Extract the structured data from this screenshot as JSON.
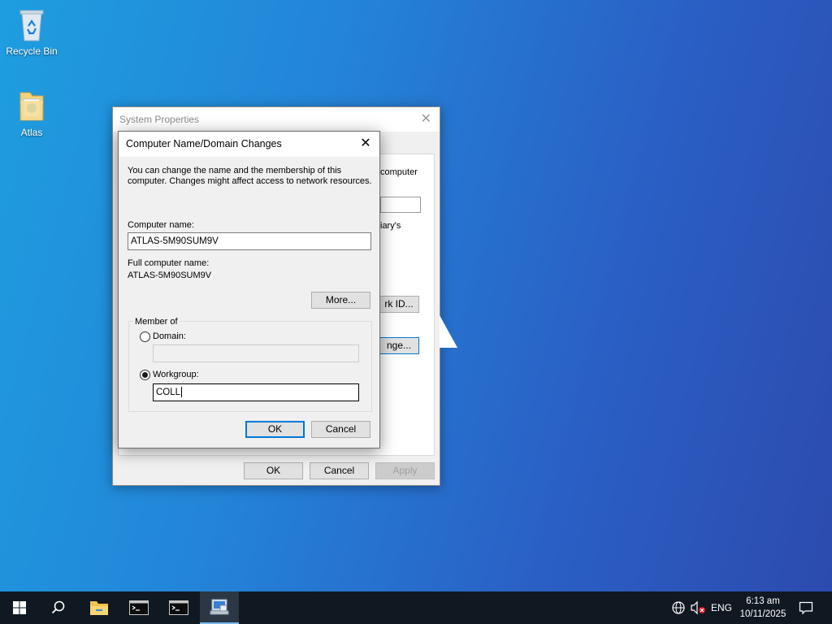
{
  "desktop": {
    "icons": [
      {
        "label": "Recycle Bin"
      },
      {
        "label": "Atlas"
      }
    ]
  },
  "system_properties": {
    "title": "System Properties",
    "partial_texts": {
      "computer": "computer",
      "arys": "iary's",
      "network_id_button": "rk ID...",
      "change_button": "nge..."
    },
    "buttons": {
      "ok": "OK",
      "cancel": "Cancel",
      "apply": "Apply"
    }
  },
  "dialog": {
    "title": "Computer Name/Domain Changes",
    "description_line1": "You can change the name and the membership of this",
    "description_line2": "computer. Changes might affect access to network resources.",
    "computer_name_label": "Computer name:",
    "computer_name_value": "ATLAS-5M90SUM9V",
    "full_name_label": "Full computer name:",
    "full_name_value": "ATLAS-5M90SUM9V",
    "more_button": "More...",
    "member_of_label": "Member of",
    "domain_label": "Domain:",
    "domain_value": "",
    "workgroup_label": "Workgroup:",
    "workgroup_value": "COLL",
    "selected_membership": "workgroup",
    "ok_button": "OK",
    "cancel_button": "Cancel"
  },
  "taskbar": {
    "items": [
      "start-icon",
      "search-icon",
      "file-explorer-icon",
      "terminal-icon",
      "terminal-icon",
      "system-properties-icon"
    ],
    "tray": {
      "language": "ENG",
      "time": "6:13 am",
      "date": "10/11/2025"
    }
  },
  "colors": {
    "accent": "#0078d7",
    "taskbar": "#101922"
  }
}
